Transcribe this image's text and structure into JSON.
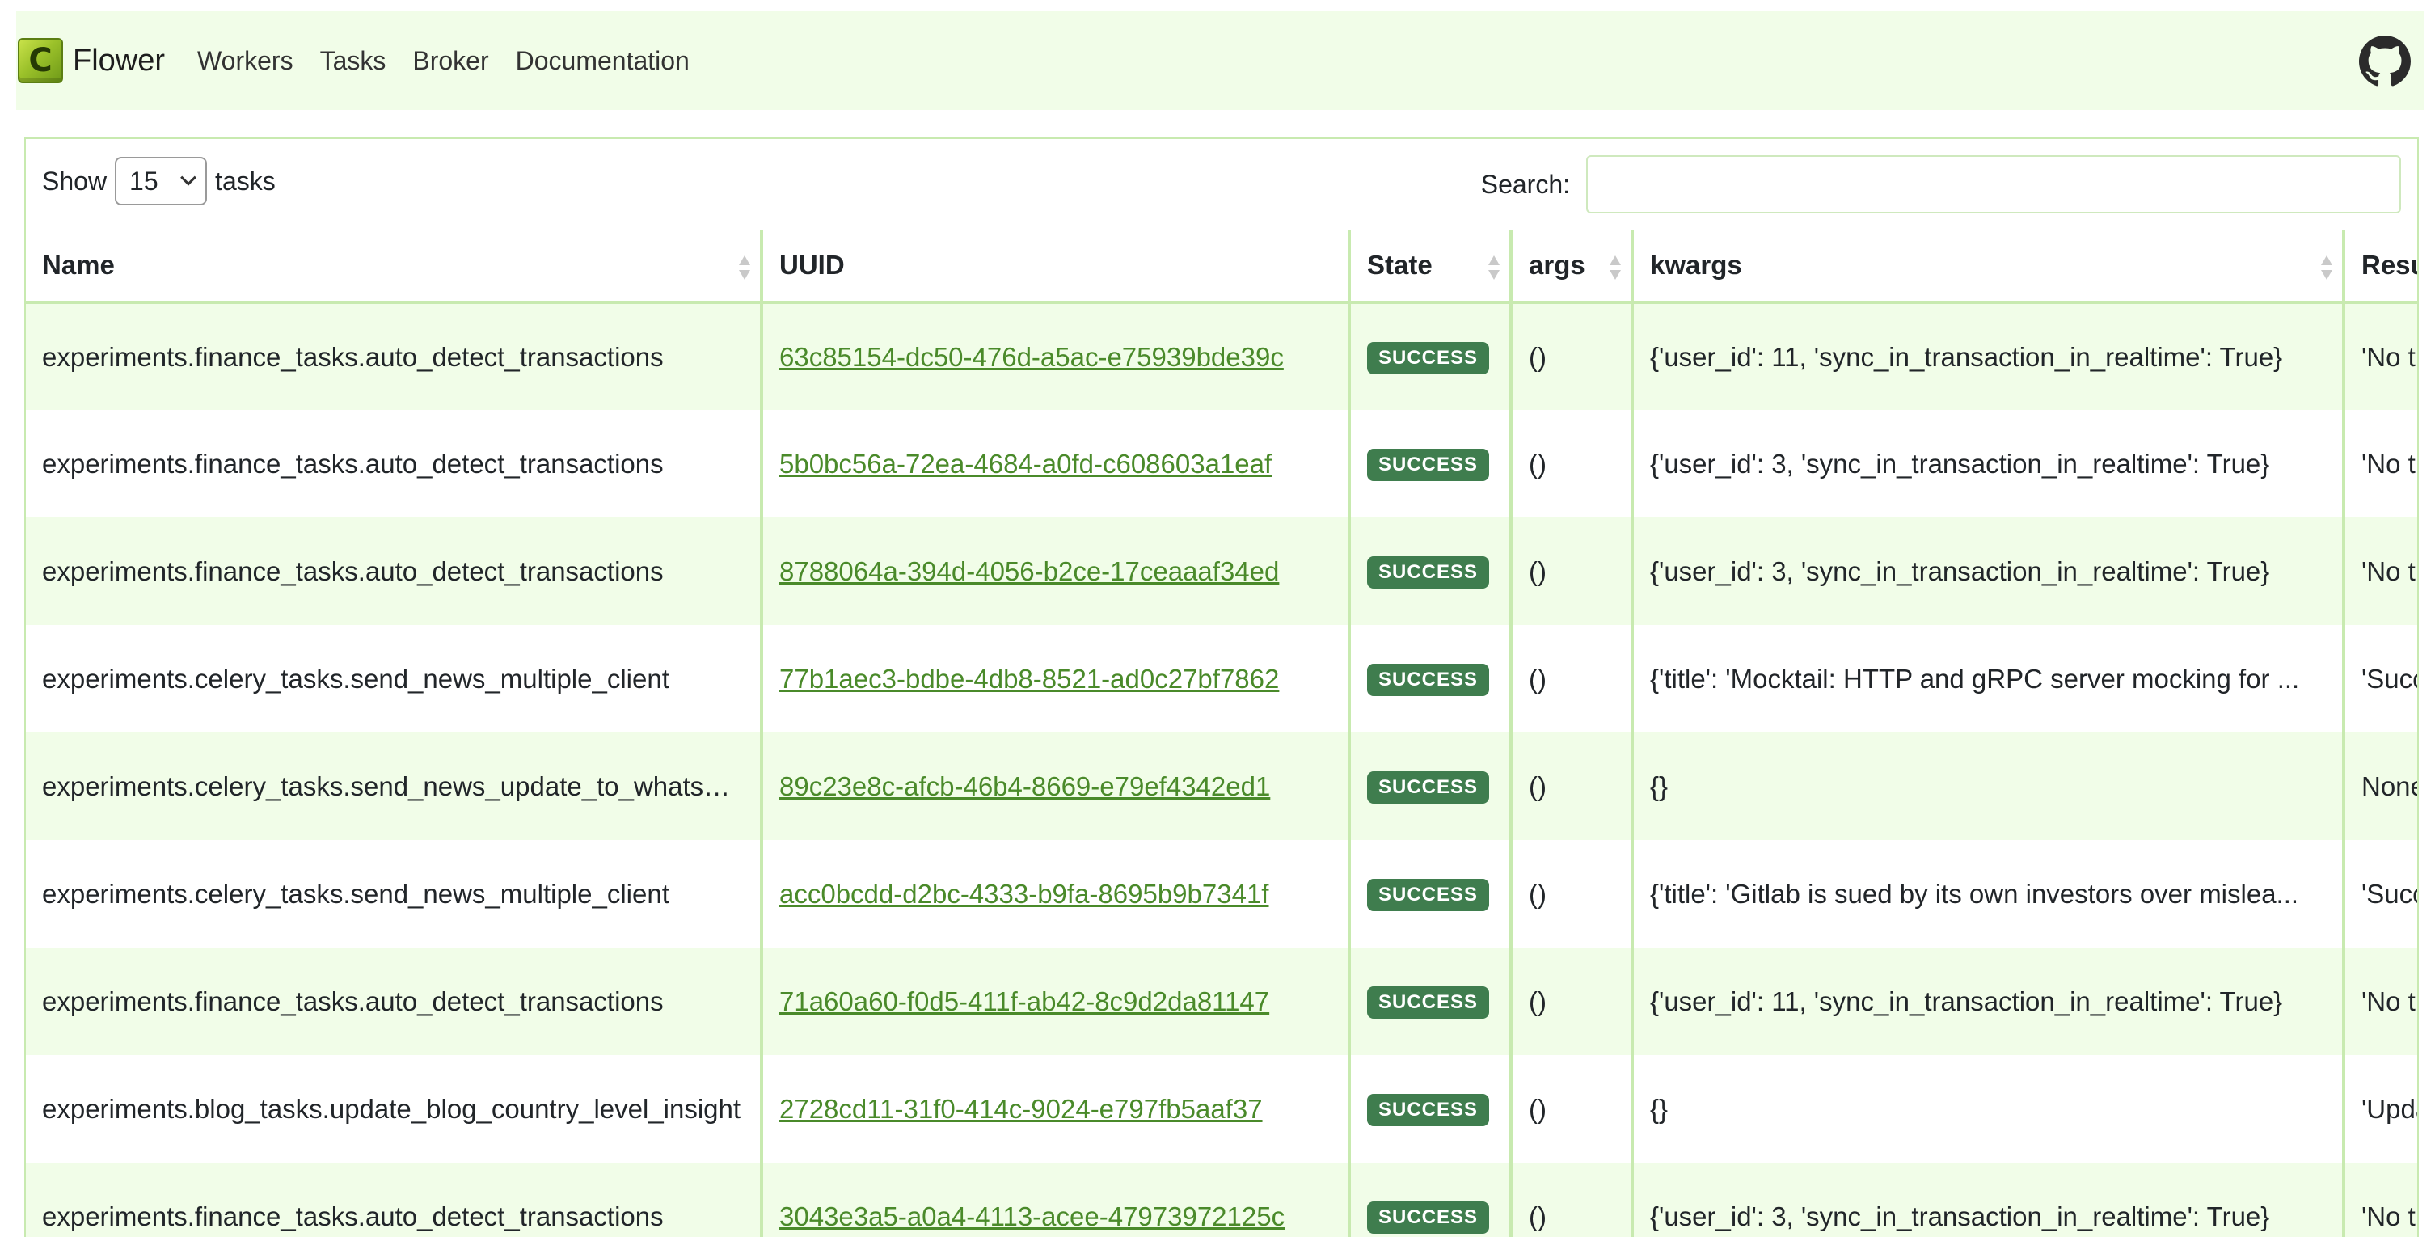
{
  "navbar": {
    "brand_letter": "C",
    "brand_name": "Flower",
    "links": [
      "Workers",
      "Tasks",
      "Broker",
      "Documentation"
    ]
  },
  "controls": {
    "show_label": "Show",
    "page_length": "15",
    "tasks_label": "tasks",
    "search_label": "Search:",
    "search_value": ""
  },
  "table": {
    "columns": [
      "Name",
      "UUID",
      "State",
      "args",
      "kwargs",
      "Result"
    ],
    "rows": [
      {
        "name": "experiments.finance_tasks.auto_detect_transactions",
        "uuid": "63c85154-dc50-476d-a5ac-e75939bde39c",
        "state": "SUCCESS",
        "args": "()",
        "kwargs": "{'user_id': 11, 'sync_in_transaction_in_realtime': True}",
        "result": "'No trans"
      },
      {
        "name": "experiments.finance_tasks.auto_detect_transactions",
        "uuid": "5b0bc56a-72ea-4684-a0fd-c608603a1eaf",
        "state": "SUCCESS",
        "args": "()",
        "kwargs": "{'user_id': 3, 'sync_in_transaction_in_realtime': True}",
        "result": "'No trans"
      },
      {
        "name": "experiments.finance_tasks.auto_detect_transactions",
        "uuid": "8788064a-394d-4056-b2ce-17ceaaaf34ed",
        "state": "SUCCESS",
        "args": "()",
        "kwargs": "{'user_id': 3, 'sync_in_transaction_in_realtime': True}",
        "result": "'No trans"
      },
      {
        "name": "experiments.celery_tasks.send_news_multiple_client",
        "uuid": "77b1aec3-bdbe-4db8-8521-ad0c27bf7862",
        "state": "SUCCESS",
        "args": "()",
        "kwargs": "{'title': 'Mocktail: HTTP and gRPC server mocking for ...",
        "result": "'Success"
      },
      {
        "name": "experiments.celery_tasks.send_news_update_to_whatsapp",
        "uuid": "89c23e8c-afcb-46b4-8669-e79ef4342ed1",
        "state": "SUCCESS",
        "args": "()",
        "kwargs": "{}",
        "result": "None"
      },
      {
        "name": "experiments.celery_tasks.send_news_multiple_client",
        "uuid": "acc0bcdd-d2bc-4333-b9fa-8695b9b7341f",
        "state": "SUCCESS",
        "args": "()",
        "kwargs": "{'title': 'Gitlab is sued by its own investors over mislea...",
        "result": "'Success"
      },
      {
        "name": "experiments.finance_tasks.auto_detect_transactions",
        "uuid": "71a60a60-f0d5-411f-ab42-8c9d2da81147",
        "state": "SUCCESS",
        "args": "()",
        "kwargs": "{'user_id': 11, 'sync_in_transaction_in_realtime': True}",
        "result": "'No trans"
      },
      {
        "name": "experiments.blog_tasks.update_blog_country_level_insight",
        "uuid": "2728cd11-31f0-414c-9024-e797fb5aaf37",
        "state": "SUCCESS",
        "args": "()",
        "kwargs": "{}",
        "result": "'Updated"
      },
      {
        "name": "experiments.finance_tasks.auto_detect_transactions",
        "uuid": "3043e3a5-a0a4-4113-acee-47973972125c",
        "state": "SUCCESS",
        "args": "()",
        "kwargs": "{'user_id': 3, 'sync_in_transaction_in_realtime': True}",
        "result": "'No trans"
      }
    ]
  },
  "icons": {
    "brand": "celery-logo-icon",
    "github": "github-icon",
    "sort": "sort-icon",
    "select": "chevron-down-icon"
  },
  "colors": {
    "navbar_bg": "#f1fde8",
    "row_stripe": "#f1fde8",
    "border": "#c8eab0",
    "link": "#4a8a2a",
    "success_badge": "#3f7d4e"
  }
}
